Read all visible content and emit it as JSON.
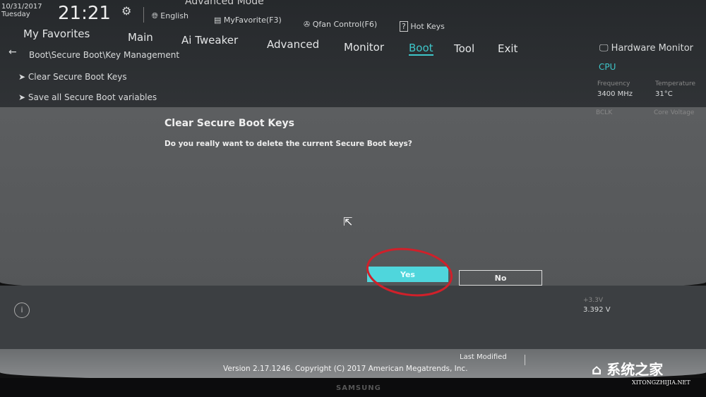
{
  "header": {
    "mode": "Advanced Mode",
    "date": "10/31/2017",
    "day": "Tuesday",
    "time": "21:21",
    "language": "English",
    "myfavorite": "MyFavorite(F3)",
    "qfan": "Qfan Control(F6)",
    "hotkeys": "Hot Keys"
  },
  "nav": {
    "tabs": [
      "My Favorites",
      "Main",
      "Ai Tweaker",
      "Advanced",
      "Monitor",
      "Boot",
      "Tool",
      "Exit"
    ],
    "active": "Boot"
  },
  "breadcrumb": "Boot\\Secure Boot\\Key Management",
  "menu": [
    "Clear Secure Boot Keys",
    "Save all Secure Boot variables"
  ],
  "dialog": {
    "title": "Clear Secure Boot Keys",
    "message": "Do you really want to delete the current Secure Boot keys?",
    "yes": "Yes",
    "no": "No"
  },
  "hw": {
    "title": "Hardware Monitor",
    "section": "CPU",
    "freq_label": "Frequency",
    "freq": "3400 MHz",
    "temp_label": "Temperature",
    "temp": "31°C",
    "bclk_label": "BCLK",
    "cv_label": "Core Voltage",
    "v33_label": "+3.3V",
    "v33": "3.392 V"
  },
  "footer": {
    "last_modified": "Last Modified",
    "version": "Version 2.17.1246. Copyright (C) 2017 American Megatrends, Inc.",
    "brand": "SAMSUNG",
    "watermark": "系统之家",
    "watermark_url": "XITONGZHIJIA.NET"
  },
  "colors": {
    "accent": "#3ec6c9",
    "yes_bg": "#4fd6dc",
    "annotation": "#d0202a"
  }
}
